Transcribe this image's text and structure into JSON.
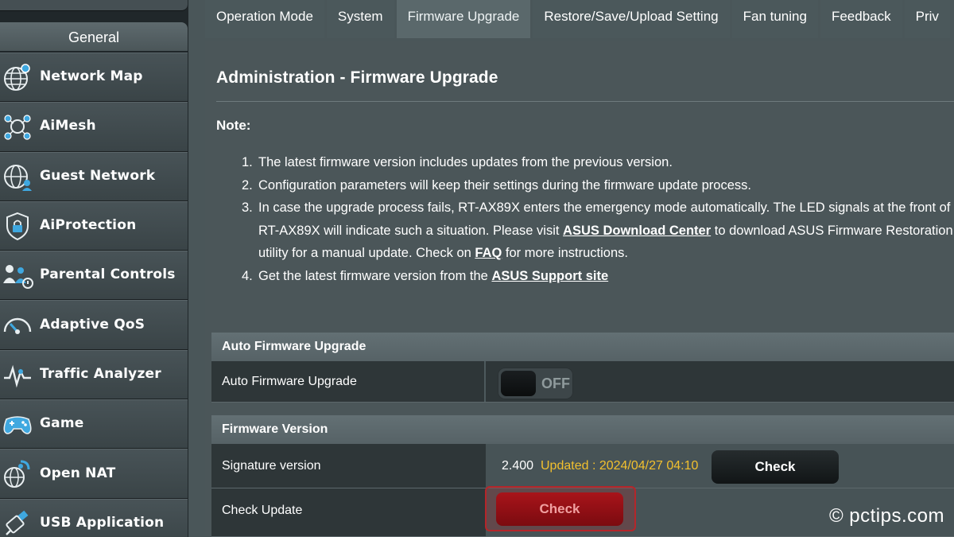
{
  "sidebar": {
    "header": "General",
    "items": [
      {
        "label": "Network Map",
        "icon": "globe-network-icon"
      },
      {
        "label": "AiMesh",
        "icon": "mesh-icon"
      },
      {
        "label": "Guest Network",
        "icon": "guest-globe-icon"
      },
      {
        "label": "AiProtection",
        "icon": "lock-shield-icon"
      },
      {
        "label": "Parental Controls",
        "icon": "family-icon"
      },
      {
        "label": "Adaptive QoS",
        "icon": "gauge-icon"
      },
      {
        "label": "Traffic Analyzer",
        "icon": "pulse-icon"
      },
      {
        "label": "Game",
        "icon": "gamepad-icon"
      },
      {
        "label": "Open NAT",
        "icon": "nat-globe-icon"
      },
      {
        "label": "USB Application",
        "icon": "usb-icon"
      }
    ]
  },
  "tabs": [
    {
      "label": "Operation Mode",
      "active": false
    },
    {
      "label": "System",
      "active": false
    },
    {
      "label": "Firmware Upgrade",
      "active": true
    },
    {
      "label": "Restore/Save/Upload Setting",
      "active": false
    },
    {
      "label": "Fan tuning",
      "active": false
    },
    {
      "label": "Feedback",
      "active": false
    },
    {
      "label": "Priv",
      "active": false
    }
  ],
  "page": {
    "title": "Administration - Firmware Upgrade",
    "note_label": "Note:",
    "notes": {
      "n1": "The latest firmware version includes updates from the previous version.",
      "n2": "Configuration parameters will keep their settings during the firmware update process.",
      "n3_a": "In case the upgrade process fails, RT-AX89X enters the emergency mode automatically. The LED signals at the front of",
      "n3_b": "RT-AX89X will indicate such a situation. Please visit ",
      "n3_link1": "ASUS Download Center",
      "n3_c": " to download ASUS Firmware Restoration",
      "n3_d": "utility for a manual update. Check on ",
      "n3_link2": "FAQ",
      "n3_e": " for more instructions.",
      "n4": "Get the latest firmware version from the ",
      "n4_link": "ASUS Support site"
    }
  },
  "auto_upgrade": {
    "header": "Auto Firmware Upgrade",
    "row_label": "Auto Firmware Upgrade",
    "toggle_state": "OFF"
  },
  "firmware_version": {
    "header": "Firmware Version",
    "signature_label": "Signature version",
    "signature_value": "2.400",
    "signature_status": "Updated : 2024/04/27 04:10",
    "signature_button": "Check",
    "check_update_label": "Check Update",
    "check_update_button": "Check"
  },
  "watermark": "© pctips.com",
  "colors": {
    "accent_red": "#a8141a",
    "status_yellow": "#f2c02e",
    "sidebar_bg": "#20272a",
    "main_bg": "#4b5659"
  }
}
